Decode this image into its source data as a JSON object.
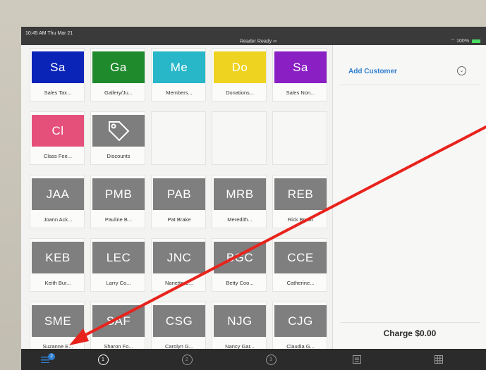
{
  "status_bar": {
    "time": "10:45 AM  Thu Mar 21",
    "reader_status": "Reader Ready ∞",
    "battery": "100%"
  },
  "tiles": [
    {
      "abbr": "Sa",
      "name": "Sales Tax...",
      "color": "#0b24b8"
    },
    {
      "abbr": "Ga",
      "name": "Gallery/Ju...",
      "color": "#1f8a2c"
    },
    {
      "abbr": "Me",
      "name": "Members...",
      "color": "#27b7c9"
    },
    {
      "abbr": "Do",
      "name": "Donations...",
      "color": "#efd321"
    },
    {
      "abbr": "Sa",
      "name": "Sales Non...",
      "color": "#8a1fc4"
    },
    {
      "abbr": "Cl",
      "name": "Class Fee...",
      "color": "#e5507a"
    },
    {
      "abbr": "",
      "name": "Discounts",
      "color": "#7e7e7e",
      "icon": "tag-icon"
    },
    {
      "abbr": "JAA",
      "name": "Joann Ack...",
      "color": "#7f7f7f"
    },
    {
      "abbr": "PMB",
      "name": "Pauline B...",
      "color": "#7f7f7f"
    },
    {
      "abbr": "PAB",
      "name": "Pat Brake",
      "color": "#7f7f7f"
    },
    {
      "abbr": "MRB",
      "name": "Meredith...",
      "color": "#7f7f7f"
    },
    {
      "abbr": "REB",
      "name": "Rick Bryan",
      "color": "#7f7f7f"
    },
    {
      "abbr": "KEB",
      "name": "Keith Bur...",
      "color": "#7f7f7f"
    },
    {
      "abbr": "LEC",
      "name": "Larry Co...",
      "color": "#7f7f7f"
    },
    {
      "abbr": "JNC",
      "name": "Nanette C...",
      "color": "#7f7f7f"
    },
    {
      "abbr": "BGC",
      "name": "Betty Coo...",
      "color": "#7f7f7f"
    },
    {
      "abbr": "CCE",
      "name": "Catherine...",
      "color": "#7f7f7f"
    },
    {
      "abbr": "SME",
      "name": "Suzanne E...",
      "color": "#7f7f7f"
    },
    {
      "abbr": "SAF",
      "name": "Sharon Fo...",
      "color": "#7f7f7f"
    },
    {
      "abbr": "CSG",
      "name": "Carolyn G...",
      "color": "#7f7f7f"
    },
    {
      "abbr": "NJG",
      "name": "Nancy Gar...",
      "color": "#7f7f7f"
    },
    {
      "abbr": "CJG",
      "name": "Claudia G...",
      "color": "#7f7f7f"
    }
  ],
  "cart": {
    "add_customer": "Add Customer",
    "charge": "Charge $0.00"
  },
  "tab_bar": {
    "menu_badge": "2",
    "page_1": "1",
    "page_2": "2",
    "page_3": "3",
    "icons": [
      "menu-icon",
      "keypad-list-icon",
      "grid-icon"
    ]
  },
  "annotation": {
    "arrow_color": "#e8231c"
  }
}
